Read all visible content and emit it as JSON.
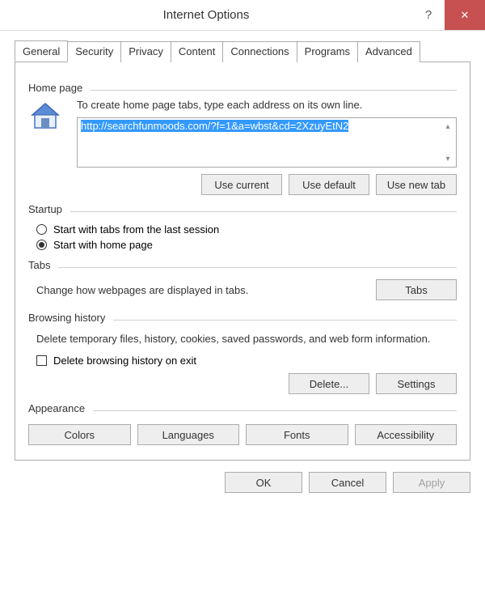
{
  "titlebar": {
    "title": "Internet Options"
  },
  "tabs": [
    "General",
    "Security",
    "Privacy",
    "Content",
    "Connections",
    "Programs",
    "Advanced"
  ],
  "homepage": {
    "label": "Home page",
    "desc": "To create home page tabs, type each address on its own line.",
    "url": "http://searchfunmoods.com/?f=1&a=wbst&cd=2XzuyEtN2",
    "use_current": "Use current",
    "use_default": "Use default",
    "use_new_tab": "Use new tab"
  },
  "startup": {
    "label": "Startup",
    "opt_last": "Start with tabs from the last session",
    "opt_home": "Start with home page"
  },
  "tabs_section": {
    "label": "Tabs",
    "desc": "Change how webpages are displayed in tabs.",
    "button": "Tabs"
  },
  "history": {
    "label": "Browsing history",
    "desc": "Delete temporary files, history, cookies, saved passwords, and web form information.",
    "check_label": "Delete browsing history on exit",
    "delete_btn": "Delete...",
    "settings_btn": "Settings"
  },
  "appearance": {
    "label": "Appearance",
    "colors": "Colors",
    "languages": "Languages",
    "fonts": "Fonts",
    "accessibility": "Accessibility"
  },
  "footer": {
    "ok": "OK",
    "cancel": "Cancel",
    "apply": "Apply"
  }
}
